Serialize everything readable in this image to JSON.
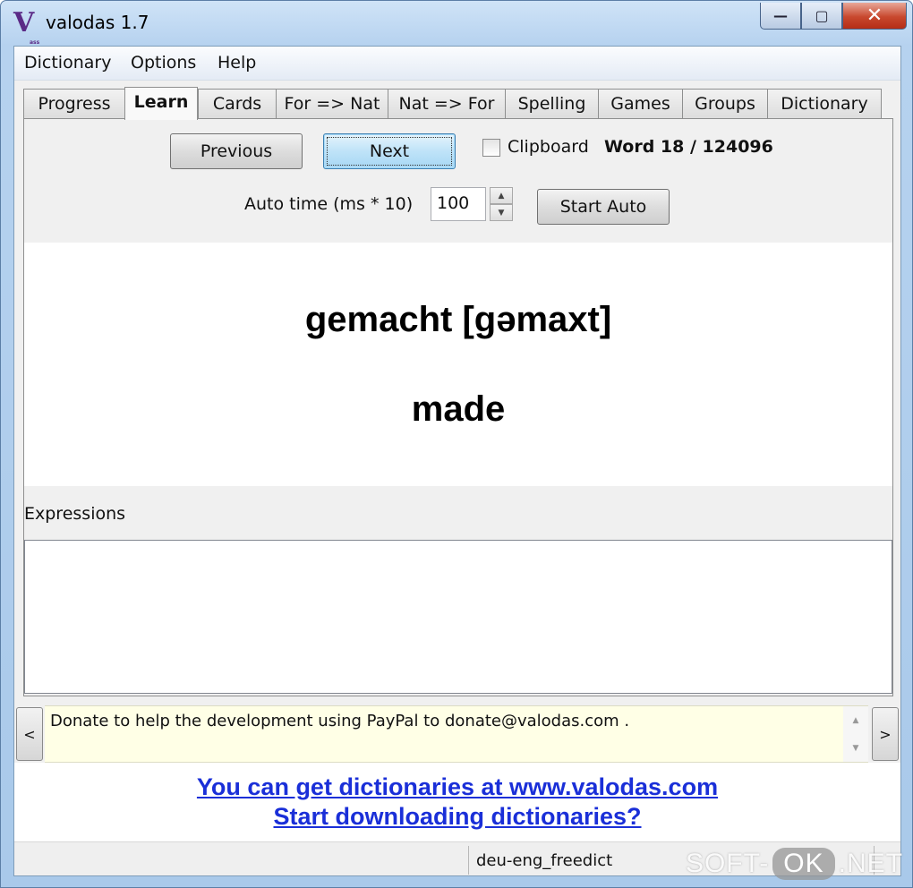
{
  "window": {
    "title": "valodas 1.7",
    "logo_letter": "V",
    "logo_small": "ass",
    "minimize": "—",
    "maximize": "▢",
    "close": "✕"
  },
  "menu": [
    "Dictionary",
    "Options",
    "Help"
  ],
  "tabs": [
    {
      "label": "Progress",
      "active": false
    },
    {
      "label": "Learn",
      "active": true
    },
    {
      "label": "Cards",
      "active": false
    },
    {
      "label": "For => Nat",
      "active": false
    },
    {
      "label": "Nat => For",
      "active": false
    },
    {
      "label": "Spelling",
      "active": false
    },
    {
      "label": "Games",
      "active": false
    },
    {
      "label": "Groups",
      "active": false
    },
    {
      "label": "Dictionary",
      "active": false
    }
  ],
  "learn": {
    "previous_label": "Previous",
    "next_label": "Next",
    "clipboard_label": "Clipboard",
    "clipboard_checked": false,
    "word_counter": "Word 18 / 124096",
    "auto_time_label": "Auto time (ms * 10)",
    "auto_time_value": "100",
    "start_auto_label": "Start Auto",
    "word_foreign": "gemacht [gəmaxt]",
    "word_native": "made",
    "expressions_label": "Expressions",
    "expressions_text": ""
  },
  "donate": {
    "prev": "<",
    "next": ">",
    "text": "Donate to help the development using PayPal to donate@valodas.com ."
  },
  "links": {
    "get_dictionaries": "You can get dictionaries at www.valodas.com",
    "start_downloading": "Start downloading dictionaries?"
  },
  "status": {
    "dictionary": "deu-eng_freedict"
  },
  "watermark": {
    "part1": "SOFT-",
    "part2": "OK",
    "part3": ".NET"
  }
}
